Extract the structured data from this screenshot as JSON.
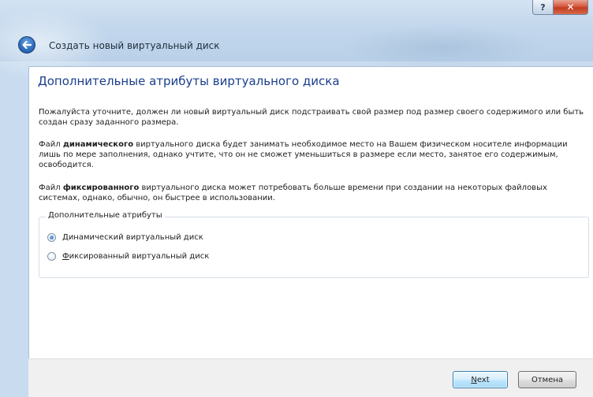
{
  "window": {
    "help_glyph": "?",
    "close_glyph": "✕",
    "wizard_caption": "Создать новый виртуальный диск"
  },
  "page": {
    "title": "Дополнительные атрибуты виртуального диска",
    "p1": "Пожалуйста уточните, должен ли новый виртуальный диск подстраивать свой размер под размер своего содержимого или быть создан сразу заданного размера.",
    "p2_before": "Файл ",
    "p2_bold": "динамического",
    "p2_after": " виртуального диска будет занимать необходимое место на Вашем физическом носителе информации лишь по мере заполнения, однако учтите, что он не сможет уменьшиться в размере если место, занятое его содержимым, освободится.",
    "p3_before": "Файл ",
    "p3_bold": "фиксированного",
    "p3_after": " виртуального диска может потребовать больше времени при создании на некоторых файловых системах, однако, обычно, он быстрее в использовании."
  },
  "group": {
    "legend": "Дополнительные атрибуты",
    "options": [
      {
        "label": "Динамический виртуальный диск",
        "selected": true
      },
      {
        "label": "Фиксированный виртуальный диск",
        "selected": false
      }
    ]
  },
  "buttons": {
    "next": "Next",
    "cancel": "Отмена"
  },
  "colors": {
    "title_blue": "#1a3e8c",
    "close_red": "#c23c1e"
  }
}
